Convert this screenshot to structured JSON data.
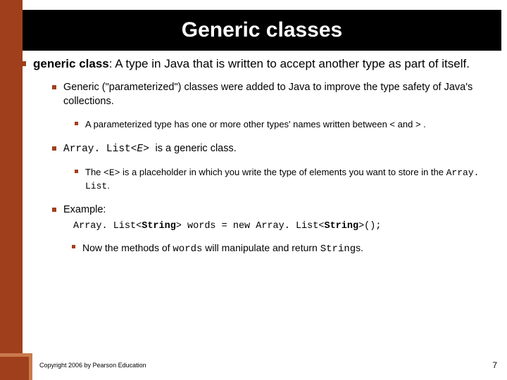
{
  "title": "Generic classes",
  "main": {
    "term": "generic class",
    "def": ": A type in Java that is written to accept another type as part of itself."
  },
  "sub1": {
    "text": "Generic (\"parameterized\") classes were added to Java to improve the type safety of Java's collections.",
    "subsub": "A parameterized type has one or more other types' names written between < and > ."
  },
  "sub2": {
    "pre": "Array. List<",
    "em": "E",
    "post": "> ",
    "rest": "is a generic class.",
    "subsub_a": "The ",
    "subsub_b": "<E>",
    "subsub_c": " is a placeholder in which you write the type of elements you want to store in the ",
    "subsub_d": "Array. List",
    "subsub_e": "."
  },
  "sub3": {
    "label": "Example:",
    "code": "Array. List<String> words = new Array. List<String>();",
    "code_pre": "Array. List<",
    "code_b1": "String",
    "code_mid": "> words = new Array. List<",
    "code_b2": "String",
    "code_post": ">();",
    "note_a": "Now the methods of ",
    "note_b": "words",
    "note_c": " will manipulate and return ",
    "note_d": "String",
    "note_e": "s."
  },
  "footer": "Copyright 2006 by Pearson Education",
  "page": "7"
}
